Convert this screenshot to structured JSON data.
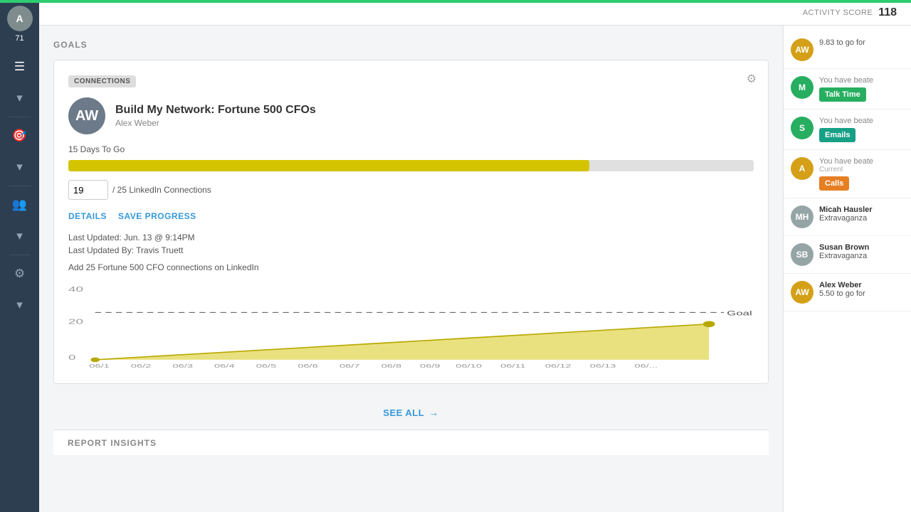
{
  "sidebar": {
    "score": "71",
    "icons": [
      "☰",
      "▾",
      "🎯",
      "▾",
      "👥",
      "▾",
      "⚙",
      "▾"
    ]
  },
  "topbar": {
    "activity_score_label": "ACTIVITY SCORE",
    "activity_score_value": "118"
  },
  "goals_section": {
    "title": "Goals",
    "goal_card": {
      "tag": "CONNECTIONS",
      "avatar_initials": "AW",
      "goal_title": "Build My Network: Fortune 500 CFOs",
      "goal_subtitle": "Alex Weber",
      "days_to_go": "15 Days To Go",
      "progress_current": "19",
      "progress_total": "25",
      "progress_unit": "LinkedIn Connections",
      "progress_pct": 76,
      "links": [
        "DETAILS",
        "SAVE PROGRESS"
      ],
      "last_updated": "Last Updated: Jun. 13 @ 9:14PM",
      "last_updated_by": "Last Updated By: Travis Truett",
      "description": "Add 25 Fortune 500 CFO connections on LinkedIn",
      "chart": {
        "y_labels": [
          "40",
          "20",
          "0"
        ],
        "x_labels": [
          "06/1",
          "06/2",
          "06/3",
          "06/4",
          "06/5",
          "06/6",
          "06/7",
          "06/8",
          "06/9",
          "06/10",
          "06/11",
          "06/12",
          "06/13",
          "06/..."
        ],
        "goal_value": 25,
        "goal_label": "Goal"
      }
    }
  },
  "see_all": {
    "label": "SEE ALL",
    "arrow": "→"
  },
  "report_insights": {
    "title": "Report Insights"
  },
  "right_panel": {
    "entries": [
      {
        "avatar": "AW",
        "avatar_color": "gold",
        "score": "9.83",
        "text": "to go for",
        "action": null
      },
      {
        "avatar": "M",
        "avatar_color": "green",
        "text": "You have beate",
        "action_label": "Talk Time",
        "action_color": "btn-green"
      },
      {
        "avatar": "S",
        "avatar_color": "green",
        "text": "You have beate",
        "action_label": "Emails",
        "action_color": "btn-teal"
      },
      {
        "avatar": "A",
        "avatar_color": "gold",
        "text": "You have beate",
        "current_label": "Current",
        "action_label": "Calls",
        "action_color": "btn-orange"
      },
      {
        "avatar": "MH",
        "avatar_color": "gray",
        "name": "Micah Hausler",
        "event": "Extravaganza"
      },
      {
        "avatar": "SB",
        "avatar_color": "gray",
        "name": "Susan Brown",
        "event": "Extravaganza"
      },
      {
        "avatar": "AW2",
        "avatar_color": "gold",
        "score": "5.50",
        "name": "Alex Weber",
        "event": "to go for"
      }
    ]
  }
}
